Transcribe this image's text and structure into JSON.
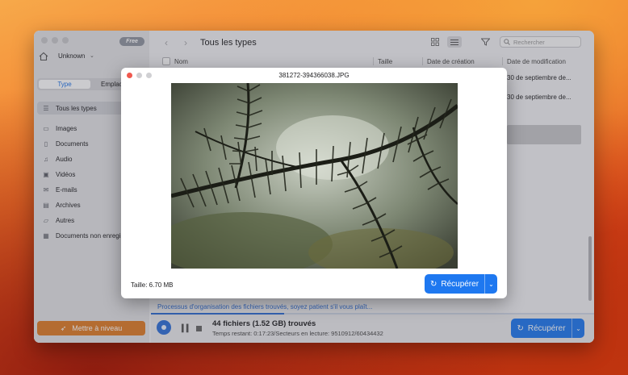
{
  "window": {
    "badge": "Free",
    "drive": "Unknown",
    "tabs": [
      "Type",
      "Emplacement"
    ],
    "title": "Tous les types",
    "search_placeholder": "Rechercher"
  },
  "sidebar": {
    "items": [
      {
        "label": "Tous les types",
        "icon": "list-icon"
      },
      {
        "label": "Images",
        "icon": "image-icon"
      },
      {
        "label": "Documents",
        "icon": "document-icon"
      },
      {
        "label": "Audio",
        "icon": "music-icon"
      },
      {
        "label": "Vidéos",
        "icon": "video-icon"
      },
      {
        "label": "E-mails",
        "icon": "mail-icon"
      },
      {
        "label": "Archives",
        "icon": "archive-icon"
      },
      {
        "label": "Autres",
        "icon": "folder-icon"
      },
      {
        "label": "Documents non enregistrés",
        "icon": "unsaved-document-icon"
      }
    ],
    "upgrade_label": "Mettre à niveau"
  },
  "table": {
    "columns": [
      "Nom",
      "Taille",
      "Date de création",
      "Date de modification"
    ],
    "rows": [
      {
        "modified": "30 de septiembre de..."
      },
      {
        "modified": "30 de septiembre de..."
      }
    ]
  },
  "status": {
    "message": "Processus d'organisation des fichiers trouvés, soyez patient s'il vous plaît...",
    "progress": 0.3,
    "found": "44 fichiers (1.52 GB) trouvés",
    "remaining": "Temps restant: 0:17:23/Secteurs en lecture: 9510912/60434432",
    "recover_label": "Récupérer"
  },
  "preview": {
    "filename": "381272-394366038.JPG",
    "size": "Taille: 6.70 MB",
    "recover_label": "Récupérer"
  },
  "colors": {
    "accent": "#1e78f0",
    "upgrade": "#e07c26",
    "status_text": "#2f6fd9"
  }
}
